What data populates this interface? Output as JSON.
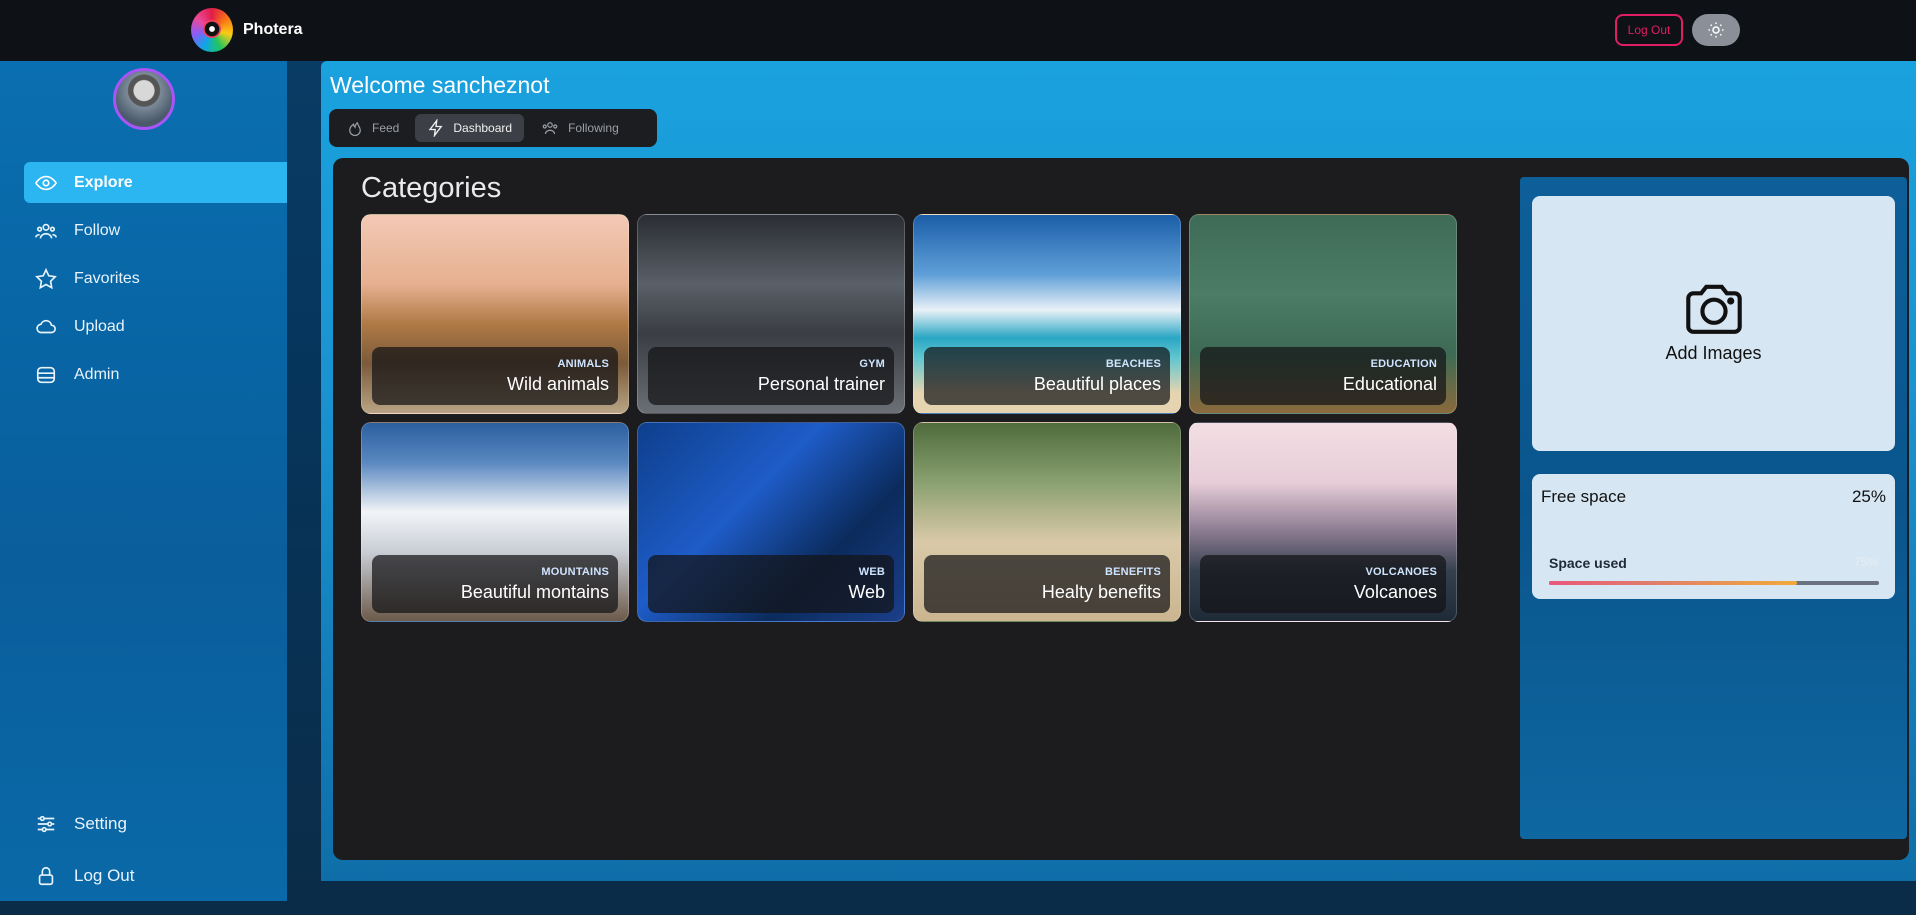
{
  "header": {
    "brand_name": "Photera",
    "logout_label": "Log Out",
    "theme_icon": "sun-icon"
  },
  "sidebar": {
    "nav_items": [
      {
        "label": "Explore",
        "icon": "eye-icon",
        "active": true
      },
      {
        "label": "Follow",
        "icon": "users-icon",
        "active": false
      },
      {
        "label": "Favorites",
        "icon": "star-icon",
        "active": false
      },
      {
        "label": "Upload",
        "icon": "cloud-icon",
        "active": false
      },
      {
        "label": "Admin",
        "icon": "database-icon",
        "active": false
      }
    ],
    "bottom_items": [
      {
        "label": "Setting",
        "icon": "sliders-icon"
      },
      {
        "label": "Log Out",
        "icon": "lock-icon"
      }
    ]
  },
  "main": {
    "welcome": "Welcome sancheznot",
    "tabs": [
      {
        "label": "Feed",
        "icon": "flame-icon",
        "active": false
      },
      {
        "label": "Dashboard",
        "icon": "lightning-icon",
        "active": true
      },
      {
        "label": "Following",
        "icon": "users-icon",
        "active": false
      }
    ],
    "categories_title": "Categories",
    "categories": [
      {
        "tag": "ANIMALS",
        "name": "Wild animals"
      },
      {
        "tag": "GYM",
        "name": "Personal trainer"
      },
      {
        "tag": "BEACHES",
        "name": "Beautiful places"
      },
      {
        "tag": "EDUCATION",
        "name": "Educational"
      },
      {
        "tag": "MOUNTAINS",
        "name": "Beautiful montains"
      },
      {
        "tag": "WEB",
        "name": "Web"
      },
      {
        "tag": "BENEFITS",
        "name": "Healty benefits"
      },
      {
        "tag": "VOLCANOES",
        "name": "Volcanoes"
      }
    ]
  },
  "storage": {
    "add_images_label": "Add Images",
    "free_space_label": "Free space",
    "free_space_value": "25%",
    "space_used_label": "Space used",
    "space_used_value": "75%",
    "space_used_fraction": 0.75
  },
  "colors": {
    "accent": "#2bb6f2",
    "logout_border": "#e11d63",
    "panel_bg": "#1c1c1e"
  }
}
